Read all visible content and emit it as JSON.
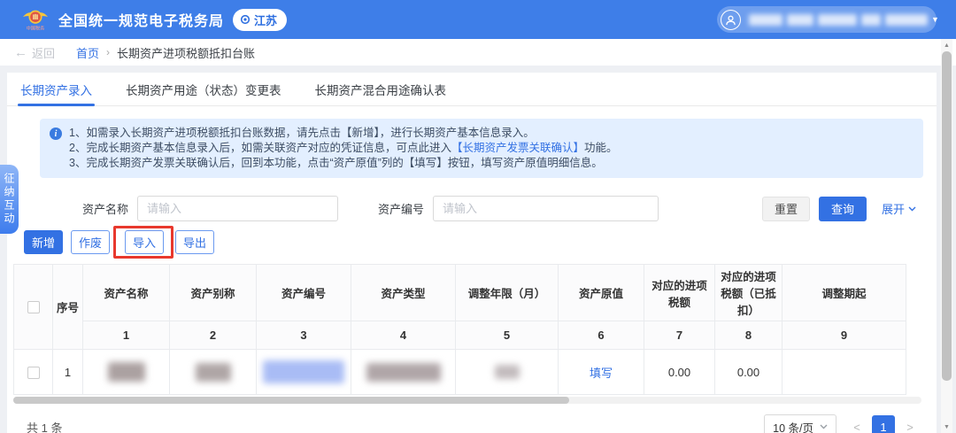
{
  "header": {
    "title": "全国统一规范电子税务局",
    "region": "江苏"
  },
  "breadcrumb": {
    "back_arrow": "←",
    "back": "返回",
    "home": "首页",
    "separator": "›",
    "current": "长期资产进项税额抵扣台账"
  },
  "side_tab": {
    "label": "征纳互动"
  },
  "tabs": [
    {
      "label": "长期资产录入"
    },
    {
      "label": "长期资产用途（状态）变更表"
    },
    {
      "label": "长期资产混合用途确认表"
    }
  ],
  "notice": {
    "icon": "i",
    "line1": "1、如需录入长期资产进项税额抵扣台账数据，请先点击【新增】，进行长期资产基本信息录入。",
    "line2_prefix": "2、完成长期资产基本信息录入后，如需关联资产对应的凭证信息，可点此进入",
    "line2_link": "【长期资产发票关联确认】",
    "line2_suffix": "功能。",
    "line3": "3、完成长期资产发票关联确认后，回到本功能，点击“资产原值”列的【填写】按钮，填写资产原值明细信息。"
  },
  "search_form": {
    "fields": [
      {
        "label": "资产名称",
        "placeholder": "请输入",
        "value": ""
      },
      {
        "label": "资产编号",
        "placeholder": "请输入",
        "value": ""
      }
    ],
    "reset_label": "重置",
    "query_label": "查询",
    "expand_label": "展开"
  },
  "actions": {
    "add_label": "新增",
    "void_label": "作废",
    "import_label": "导入",
    "export_label": "导出"
  },
  "table": {
    "columns": [
      {
        "label": "序号",
        "index": ""
      },
      {
        "label": "资产名称",
        "index": "1"
      },
      {
        "label": "资产别称",
        "index": "2"
      },
      {
        "label": "资产编号",
        "index": "3"
      },
      {
        "label": "资产类型",
        "index": "4"
      },
      {
        "label": "调整年限（月）",
        "index": "5"
      },
      {
        "label": "资产原值",
        "index": "6"
      },
      {
        "label": "对应的进项税额",
        "index": "7"
      },
      {
        "label": "对应的进项税额（已抵扣）",
        "index": "8"
      },
      {
        "label": "调整期起",
        "index": "9"
      }
    ],
    "rows": [
      {
        "seq": "1",
        "asset_value_action": "填写",
        "input_tax": "0.00",
        "input_tax_deducted": "0.00",
        "adjust_start": ""
      }
    ]
  },
  "footer": {
    "total_text": "共 1 条",
    "page_size": "10 条/页",
    "prev_icon": "<",
    "current_page": "1",
    "next_icon": ">"
  }
}
